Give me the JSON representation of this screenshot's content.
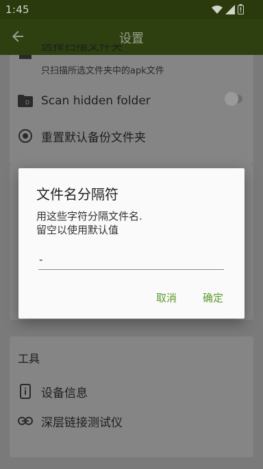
{
  "status_bar": {
    "time": "1:45",
    "icons": [
      "wifi-icon",
      "signal-icon",
      "battery-icon"
    ]
  },
  "app_bar": {
    "title": "设置",
    "back_icon": "arrow-left-icon"
  },
  "settings": {
    "scan_selected": {
      "title": "选择扫描文件夹",
      "subtitle": "只扫描所选文件夹中的apk文件"
    },
    "scan_hidden": {
      "title": "Scan hidden folder",
      "enabled": false
    },
    "reset_backup": {
      "title": "重置默认备份文件夹"
    },
    "tools_section": {
      "title": "工具"
    },
    "device_info": {
      "title": "设备信息"
    },
    "deep_link": {
      "title": "深层链接测试仪"
    }
  },
  "dialog": {
    "title": "文件名分隔符",
    "message": "用这些字符分隔文件名.\n留空以使用默认值",
    "input_value": "-",
    "cancel_label": "取消",
    "ok_label": "确定"
  },
  "colors": {
    "accent": "#5d9a2e",
    "app_bar": "#2e4010",
    "scrim": "#7a7a7a"
  }
}
